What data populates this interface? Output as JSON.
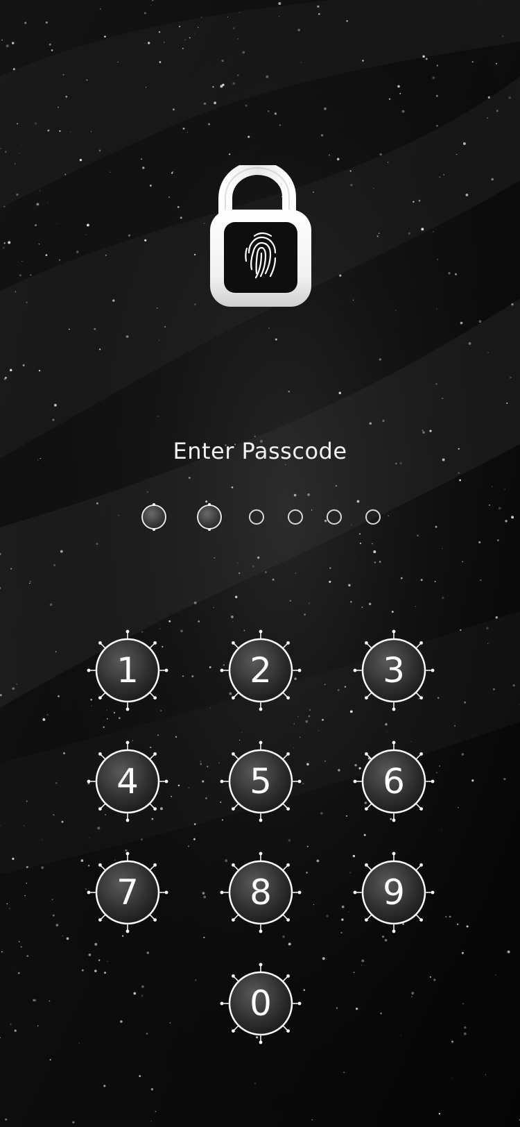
{
  "screen": {
    "title": "Enter Passcode"
  },
  "lock_icon": {
    "name": "fingerprint-lock-icon",
    "state": "unlocked"
  },
  "passcode": {
    "length": 6,
    "entered": 2
  },
  "keypad": {
    "keys": [
      "1",
      "2",
      "3",
      "4",
      "5",
      "6",
      "7",
      "8",
      "9",
      "0"
    ]
  },
  "colors": {
    "background": "#0a0a0a",
    "text": "#f2f2f2",
    "key_fill": "#2e2e2e",
    "key_border": "#ffffff"
  }
}
